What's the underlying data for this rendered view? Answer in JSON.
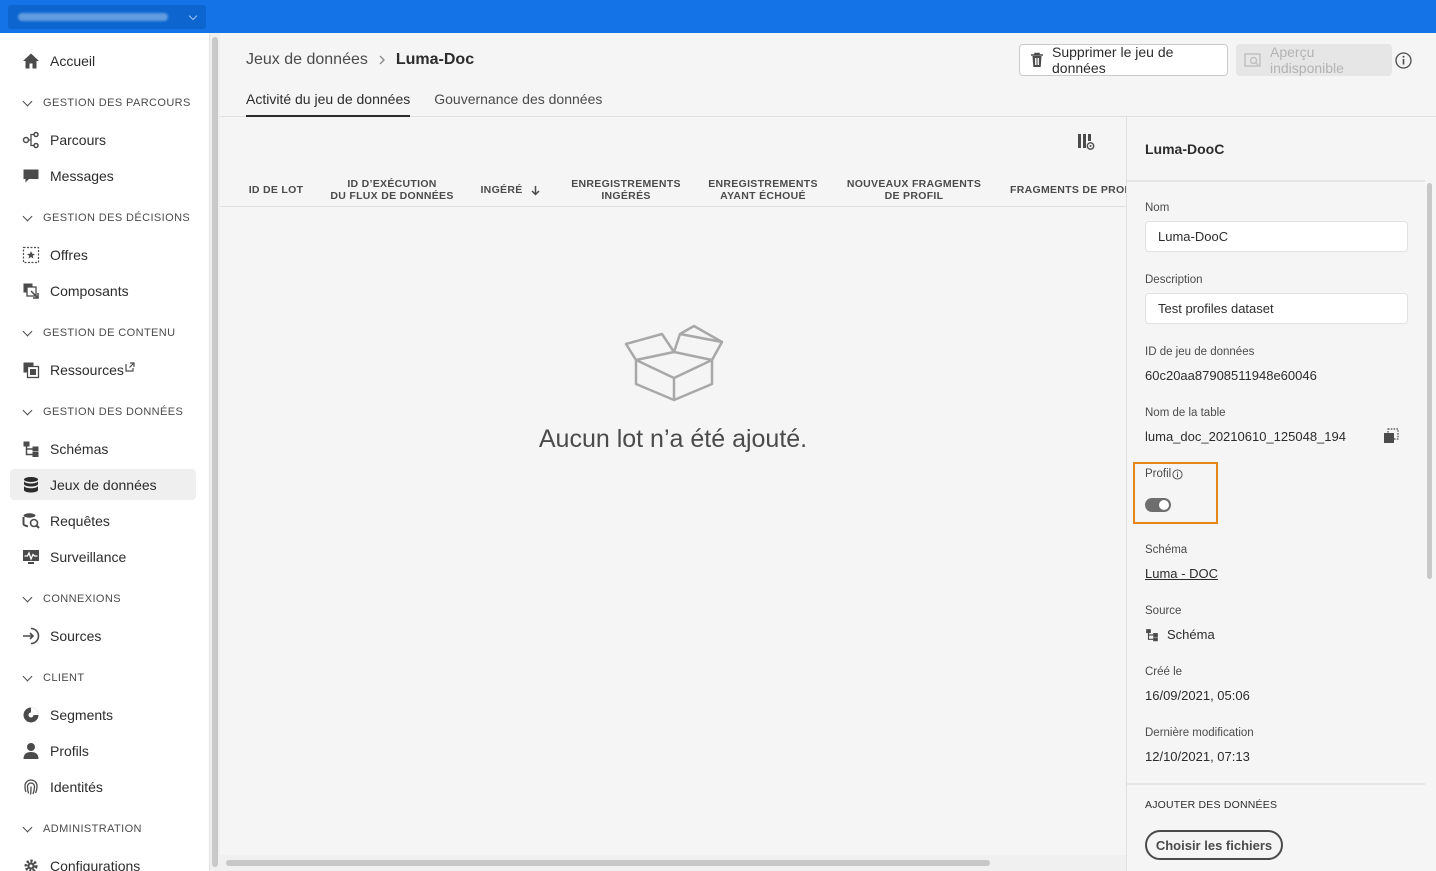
{
  "sidebar": {
    "items": {
      "home": "Accueil",
      "journeys_section": "GESTION DES PARCOURS",
      "journeys": "Parcours",
      "messages": "Messages",
      "decisions_section": "GESTION DES DÉCISIONS",
      "offers": "Offres",
      "components": "Composants",
      "content_section": "GESTION DE CONTENU",
      "assets": "Ressources",
      "data_section": "GESTION DES DONNÉES",
      "schemas": "Schémas",
      "datasets": "Jeux de données",
      "queries": "Requêtes",
      "monitoring": "Surveillance",
      "connections_section": "CONNEXIONS",
      "sources": "Sources",
      "customer_section": "CLIENT",
      "segments": "Segments",
      "profiles": "Profils",
      "identities": "Identités",
      "admin_section": "ADMINISTRATION",
      "configurations": "Configurations"
    },
    "active": "datasets"
  },
  "header": {
    "breadcrumb_parent": "Jeux de données",
    "breadcrumb_current": "Luma-Doc",
    "delete_label": "Supprimer le jeu de données",
    "preview_label": "Aperçu indisponible",
    "tabs": {
      "activity": "Activité du jeu de données",
      "governance": "Gouvernance des données"
    }
  },
  "table": {
    "columns": {
      "batch_id": "ID DE LOT",
      "flow_run_1": "ID D’EXÉCUTION",
      "flow_run_2": "DU FLUX DE DONNÉES",
      "ingested": "INGÉRÉ",
      "records_ingested_1": "ENREGISTREMENTS",
      "records_ingested_2": "INGÉRÉS",
      "records_failed_1": "ENREGISTREMENTS",
      "records_failed_2": "AYANT ÉCHOUÉ",
      "new_fragments_1": "NOUVEAUX FRAGMENTS",
      "new_fragments_2": "DE PROFIL",
      "fragments": "FRAGMENTS DE PROF"
    },
    "empty_message": "Aucun lot n’a été ajouté."
  },
  "panel": {
    "title": "Luma-DooC",
    "name_label": "Nom",
    "name_value": "Luma-DooC",
    "description_label": "Description",
    "description_value": "Test profiles dataset",
    "dataset_id_label": "ID de jeu de données",
    "dataset_id_value": "60c20aa87908511948e60046",
    "table_name_label": "Nom de la table",
    "table_name_value": "luma_doc_20210610_125048_194",
    "profile_label": "Profil",
    "profile_enabled": true,
    "schema_label": "Schéma",
    "schema_value": "Luma - DOC",
    "source_label": "Source",
    "source_value": "Schéma",
    "created_label": "Créé le",
    "created_value": "16/09/2021, 05:06",
    "modified_label": "Dernière modification",
    "modified_value": "12/10/2021, 07:13",
    "add_data_section": "AJOUTER DES DONNÉES",
    "choose_files_label": "Choisir les fichiers"
  },
  "colors": {
    "topbar": "#1473e6",
    "highlight": "#e68619"
  }
}
